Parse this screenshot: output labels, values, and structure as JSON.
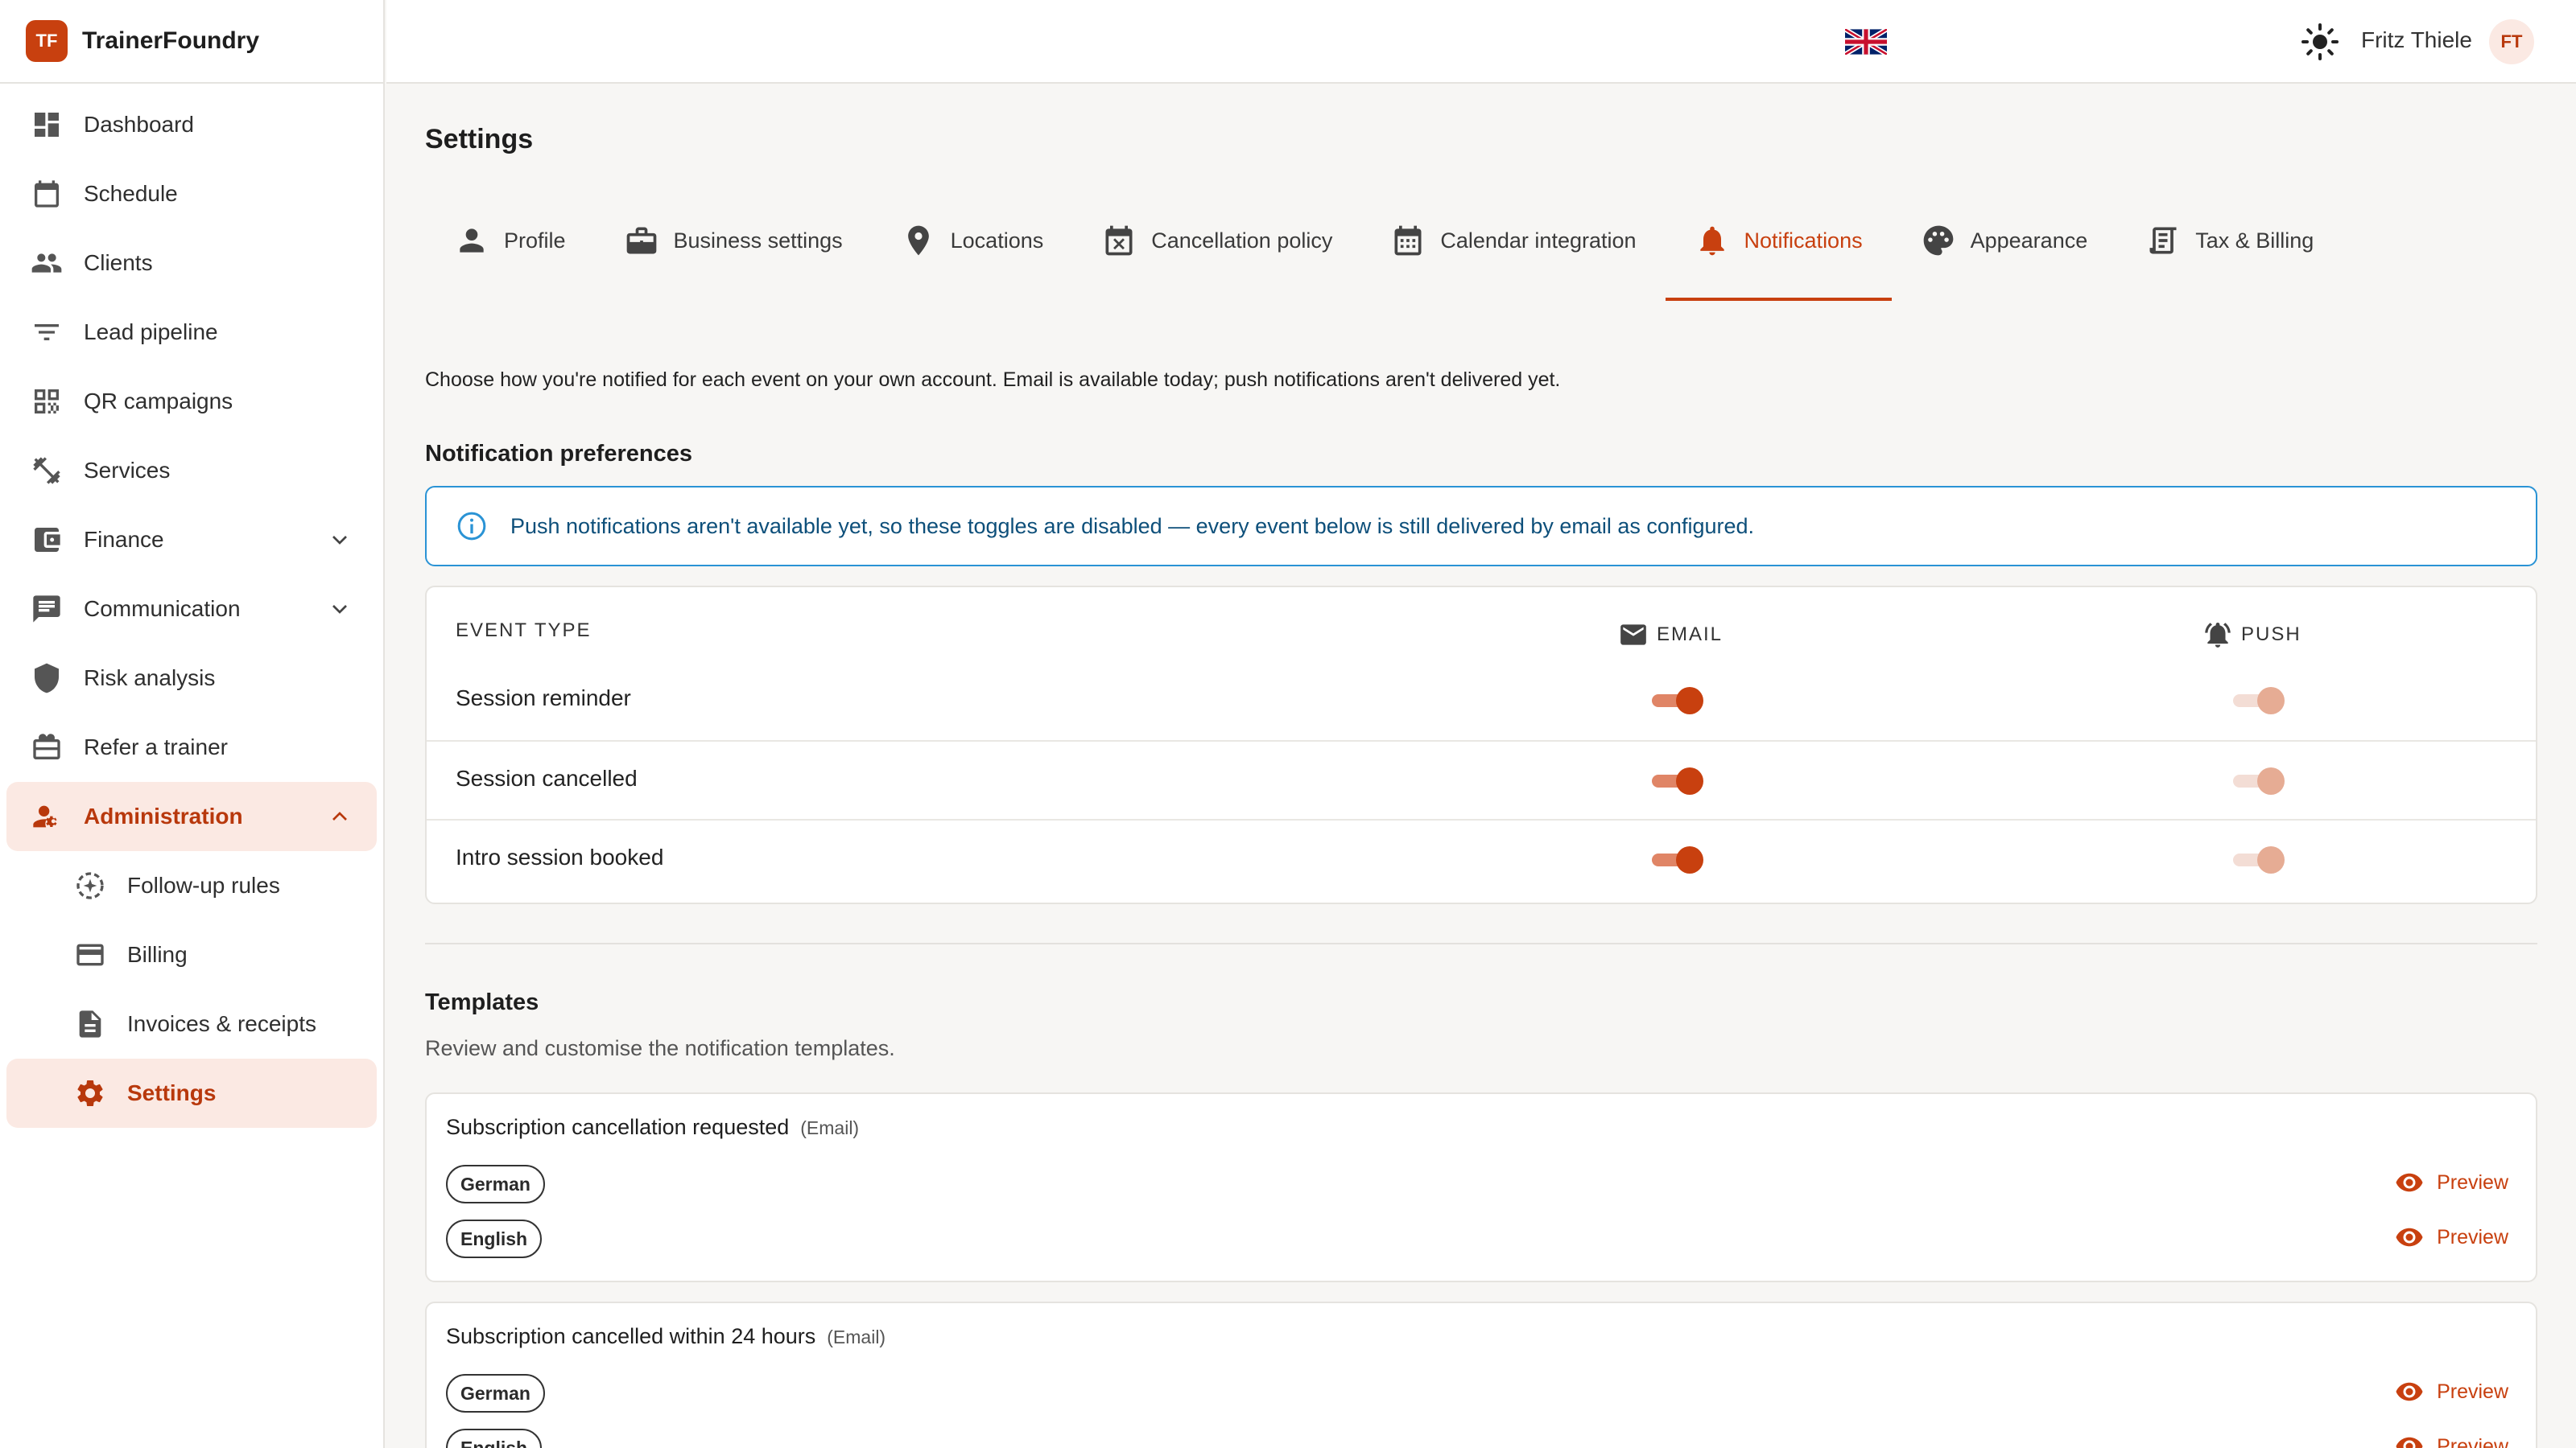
{
  "brand": {
    "logo_text": "TF",
    "name": "TrainerFoundry"
  },
  "nav": {
    "dashboard": "Dashboard",
    "schedule": "Schedule",
    "clients": "Clients",
    "lead_pipeline": "Lead pipeline",
    "qr_campaigns": "QR campaigns",
    "services": "Services",
    "finance": "Finance",
    "communication": "Communication",
    "risk_analysis": "Risk analysis",
    "refer": "Refer a trainer",
    "administration": "Administration",
    "followup": "Follow-up rules",
    "billing": "Billing",
    "invoices": "Invoices & receipts",
    "settings": "Settings"
  },
  "header": {
    "user_name": "Fritz Thiele",
    "avatar_initials": "FT"
  },
  "page": {
    "title": "Settings"
  },
  "tabs": {
    "profile": "Profile",
    "business": "Business settings",
    "locations": "Locations",
    "cancellation": "Cancellation policy",
    "calendar": "Calendar integration",
    "notifications": "Notifications",
    "appearance": "Appearance",
    "tax": "Tax & Billing"
  },
  "notifications": {
    "intro": "Choose how you're notified for each event on your own account. Email is available today; push notifications aren't delivered yet.",
    "prefs_title": "Notification preferences",
    "info_banner": "Push notifications aren't available yet, so these toggles are disabled — every event below is still delivered by email as configured.",
    "col_event": "EVENT TYPE",
    "col_email": "EMAIL",
    "col_push": "PUSH",
    "rows": [
      {
        "label": "Session reminder",
        "email": true,
        "push": true
      },
      {
        "label": "Session cancelled",
        "email": true,
        "push": true
      },
      {
        "label": "Intro session booked",
        "email": true,
        "push": true
      }
    ]
  },
  "templates": {
    "title": "Templates",
    "subtitle": "Review and customise the notification templates.",
    "preview_label": "Preview",
    "cards": [
      {
        "title": "Subscription cancellation requested",
        "kind": "(Email)",
        "languages": [
          "German",
          "English"
        ]
      },
      {
        "title": "Subscription cancelled within 24 hours",
        "kind": "(Email)",
        "languages": [
          "German",
          "English"
        ]
      }
    ]
  },
  "colors": {
    "accent": "#c8400f",
    "active_bg": "#fbe9e3",
    "info_border": "#2a93d5",
    "page_bg": "#f7f6f4"
  }
}
